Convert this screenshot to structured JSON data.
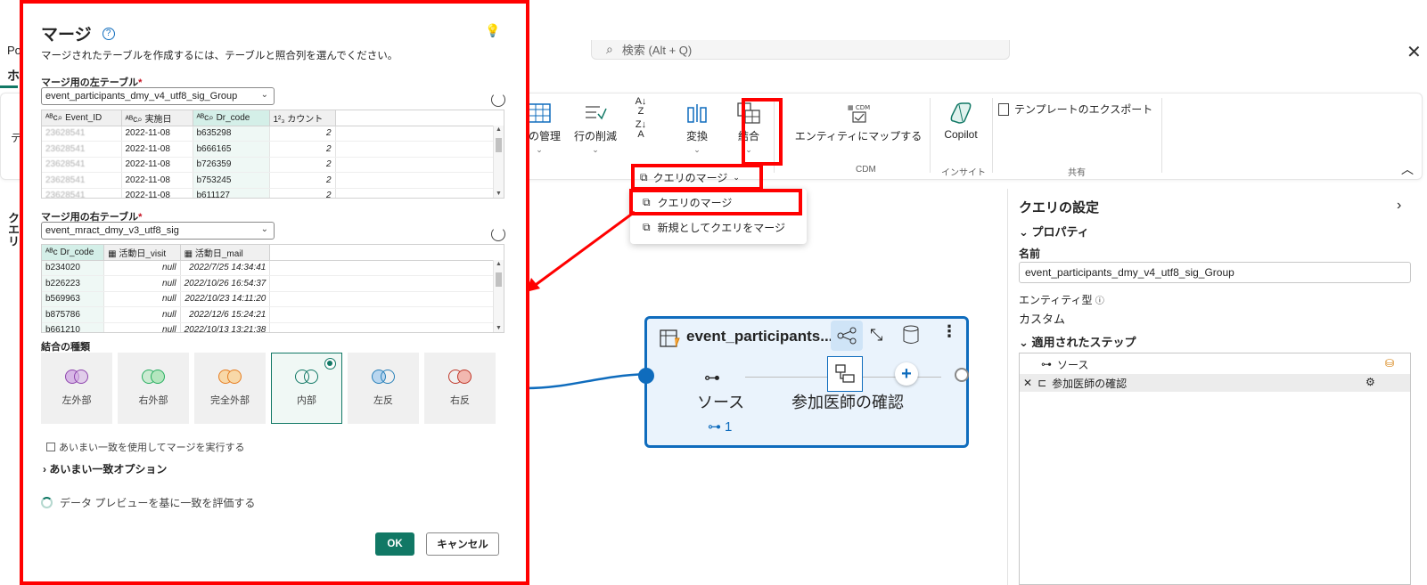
{
  "app": {
    "title_fragment": "Po",
    "tab_fragment": "ホ",
    "ribbon_fragment": "テ",
    "side_fragment": "クエリ",
    "search_placeholder": "検索 (Alt + Q)"
  },
  "ribbon": {
    "manage_columns": "列の管理",
    "remove_rows": "行の削減",
    "transform": "変換",
    "combine": "結合",
    "map_entity": "エンティティにマップする",
    "copilot": "Copilot",
    "export_template": "テンプレートのエクスポート",
    "group_cdm": "CDM",
    "group_insight": "インサイト",
    "group_share": "共有",
    "merge_split_button": "クエリのマージ"
  },
  "dropdown": {
    "items": [
      "クエリのマージ",
      "新規としてクエリをマージ"
    ]
  },
  "settings_panel": {
    "title": "クエリの設定",
    "properties": "プロパティ",
    "name_label": "名前",
    "name_value": "event_participants_dmy_v4_utf8_sig_Group",
    "entity_type_label": "エンティティ型",
    "entity_type_value": "カスタム",
    "applied_steps_label": "適用されたステップ",
    "steps": [
      "ソース",
      "参加医師の確認"
    ]
  },
  "node": {
    "title": "event_participants...",
    "step1": "ソース",
    "step2": "参加医師の確認",
    "link_count": "1"
  },
  "dialog": {
    "title": "マージ",
    "subtitle": "マージされたテーブルを作成するには、テーブルと照合列を選んでください。",
    "left_label": "マージ用の左テーブル",
    "left_table": "event_participants_dmy_v4_utf8_sig_Group",
    "left_columns": [
      "Event_ID",
      "実施日",
      "Dr_code",
      "カウント"
    ],
    "left_rows": [
      [
        "23628541",
        "2022-11-08",
        "b635298",
        "2"
      ],
      [
        "23628541",
        "2022-11-08",
        "b666165",
        "2"
      ],
      [
        "23628541",
        "2022-11-08",
        "b726359",
        "2"
      ],
      [
        "23628541",
        "2022-11-08",
        "b753245",
        "2"
      ],
      [
        "23628541",
        "2022-11-08",
        "b611127",
        "2"
      ]
    ],
    "right_label": "マージ用の右テーブル",
    "right_table": "event_mract_dmy_v3_utf8_sig",
    "right_columns": [
      "Dr_code",
      "活動日_visit",
      "活動日_mail"
    ],
    "right_rows": [
      [
        "b234020",
        "null",
        "2022/7/25 14:34:41"
      ],
      [
        "b226223",
        "null",
        "2022/10/26 16:54:37"
      ],
      [
        "b569963",
        "null",
        "2022/10/23 14:11:20"
      ],
      [
        "b875786",
        "null",
        "2022/12/6 15:24:21"
      ],
      [
        "b661210",
        "null",
        "2022/10/13 13:21:38"
      ]
    ],
    "join_label": "結合の種類",
    "join_types": [
      "左外部",
      "右外部",
      "完全外部",
      "内部",
      "左反",
      "右反"
    ],
    "fuzzy_checkbox": "あいまい一致を使用してマージを実行する",
    "fuzzy_options": "あいまい一致オプション",
    "evaluating": "データ プレビューを基に一致を評価する",
    "ok": "OK",
    "cancel": "キャンセル"
  },
  "colors": {
    "accent_green": "#117865",
    "accent_blue": "#0f6cbd",
    "highlight_red": "#ff0000"
  }
}
